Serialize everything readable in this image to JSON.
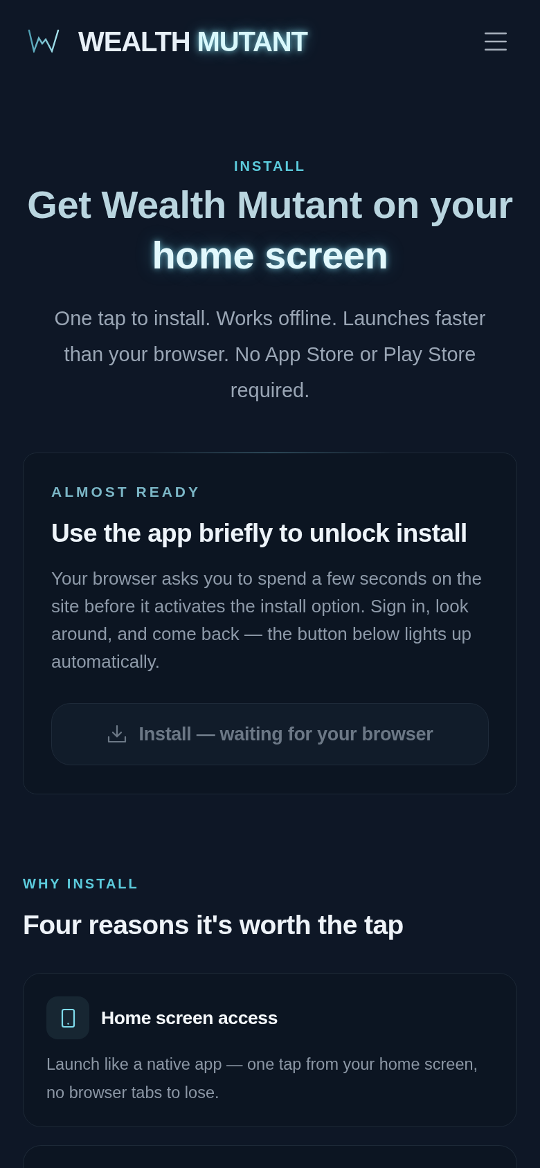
{
  "header": {
    "brand": "WEALTH",
    "brand_highlight": "MUTANT"
  },
  "hero": {
    "eyebrow": "INSTALL",
    "heading": "Get Wealth Mutant on your",
    "heading_highlight": "home screen",
    "subtitle": "One tap to install. Works offline. Launches faster than your browser. No App Store or Play Store required."
  },
  "install_card": {
    "eyebrow": "ALMOST READY",
    "title": "Use the app briefly to unlock install",
    "body": "Your browser asks you to spend a few seconds on the site before it activates the install option. Sign in, look around, and come back — the button below lights up automatically.",
    "button": {
      "label": "Install — waiting for your browser",
      "disabled": true
    }
  },
  "why_install": {
    "eyebrow": "WHY INSTALL",
    "heading": "Four reasons it's worth the tap",
    "features": [
      {
        "kind": "phone",
        "title": "Home screen access",
        "description": "Launch like a native app — one tap from your home screen, no browser tabs to lose."
      }
    ]
  }
}
